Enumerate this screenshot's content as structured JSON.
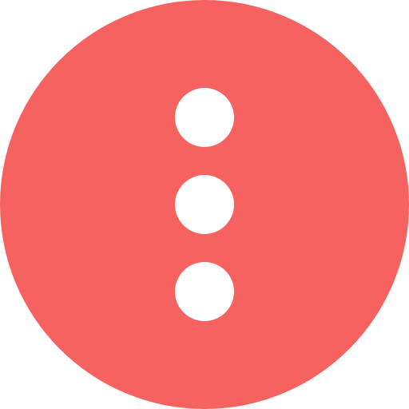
{
  "icon": {
    "name": "more-vertical-icon",
    "background_color": "#F5625F",
    "dot_color": "#FFFFFF",
    "dot_count": 3
  }
}
